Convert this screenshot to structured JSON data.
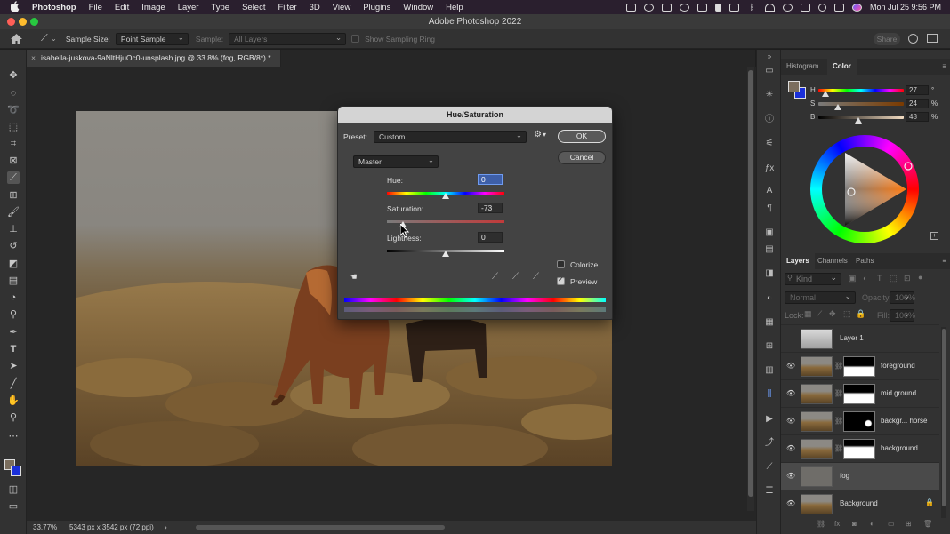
{
  "menubar": {
    "app": "Photoshop",
    "items": [
      "File",
      "Edit",
      "Image",
      "Layer",
      "Type",
      "Select",
      "Filter",
      "3D",
      "View",
      "Plugins",
      "Window",
      "Help"
    ],
    "clock": "Mon Jul 25  9:56 PM"
  },
  "window": {
    "title": "Adobe Photoshop 2022"
  },
  "options": {
    "sample_size_label": "Sample Size:",
    "sample_size_value": "Point Sample",
    "sample_label": "Sample:",
    "sample_value": "All Layers",
    "show_ring": "Show Sampling Ring",
    "share": "Share"
  },
  "document": {
    "tab_title": "isabella-juskova-9aNltHjuOc0-unsplash.jpg @ 33.8% (fog, RGB/8*) *",
    "zoom": "33.77%",
    "size_info": "5343 px x 3542 px (72 ppi)"
  },
  "dialog": {
    "title": "Hue/Saturation",
    "preset_label": "Preset:",
    "preset_value": "Custom",
    "channel_value": "Master",
    "ok": "OK",
    "cancel": "Cancel",
    "hue_label": "Hue:",
    "hue_value": "0",
    "sat_label": "Saturation:",
    "sat_value": "-73",
    "light_label": "Lightness:",
    "light_value": "0",
    "colorize_label": "Colorize",
    "colorize_checked": false,
    "preview_label": "Preview",
    "preview_checked": true,
    "hue_fraction": 0.5,
    "sat_fraction": 0.135,
    "light_fraction": 0.5
  },
  "color_panel": {
    "tabs": [
      "Histogram",
      "Color"
    ],
    "active_tab": "Color",
    "h_label": "H",
    "h_value": "27",
    "h_unit": "°",
    "s_label": "S",
    "s_value": "24",
    "s_unit": "%",
    "b_label": "B",
    "b_value": "48",
    "b_unit": "%",
    "foreground_color": "#7b6e5e",
    "background_color": "#1a2fd9"
  },
  "layers_panel": {
    "tabs": [
      "Layers",
      "Channels",
      "Paths"
    ],
    "active_tab": "Layers",
    "filter_placeholder": "Kind",
    "blend_mode": "Normal",
    "opacity_label": "Opacity:",
    "opacity_value": "100%",
    "lock_label": "Lock:",
    "fill_label": "Fill:",
    "fill_value": "100%",
    "layers": [
      {
        "name": "Layer 1",
        "visible": false,
        "mask": false,
        "selected": false
      },
      {
        "name": "foreground",
        "visible": true,
        "mask": true,
        "selected": false
      },
      {
        "name": "mid ground",
        "visible": true,
        "mask": true,
        "selected": false
      },
      {
        "name": "backgr... horse",
        "visible": true,
        "mask": true,
        "selected": false
      },
      {
        "name": "background",
        "visible": true,
        "mask": true,
        "selected": false
      },
      {
        "name": "fog",
        "visible": true,
        "mask": false,
        "selected": true
      },
      {
        "name": "Background",
        "visible": true,
        "mask": false,
        "selected": false
      }
    ]
  }
}
